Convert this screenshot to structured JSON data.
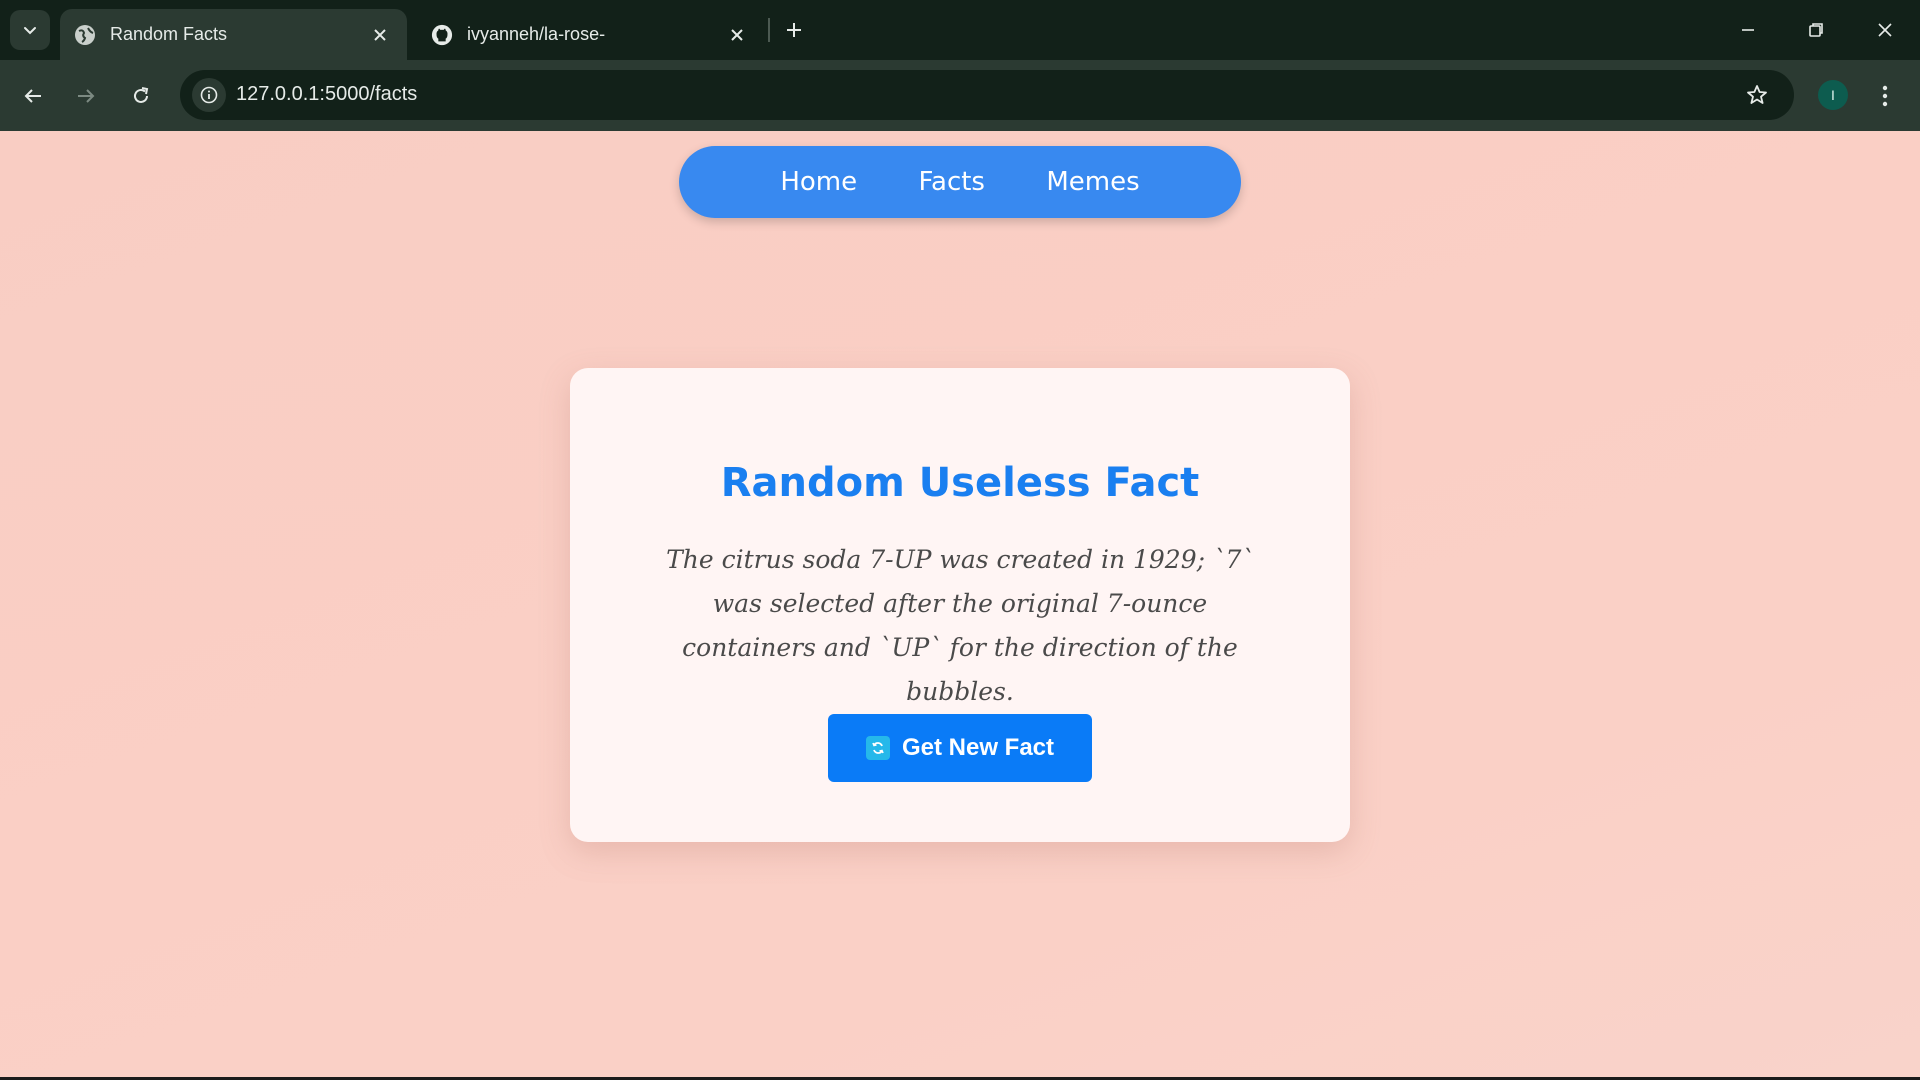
{
  "browser": {
    "tabs": [
      {
        "title": "Random Facts",
        "active": true,
        "icon": "globe-icon"
      },
      {
        "title": "ivyanneh/la-rose-",
        "active": false,
        "icon": "github-icon"
      }
    ],
    "url": "127.0.0.1:5000/facts",
    "profile_initial": "I"
  },
  "nav": {
    "items": [
      "Home",
      "Facts",
      "Memes"
    ]
  },
  "card": {
    "title": "Random Useless Fact",
    "fact": "The citrus soda 7-UP was created in 1929; `7` was selected after the original 7-ounce containers and `UP` for the direction of the bubbles.",
    "button_label": "Get New Fact"
  },
  "colors": {
    "page_background": "#f9cdc3",
    "nav_background": "#3889f0",
    "title": "#1a7ff0",
    "button": "#0a7bf7",
    "card_background": "#fff5f4"
  }
}
